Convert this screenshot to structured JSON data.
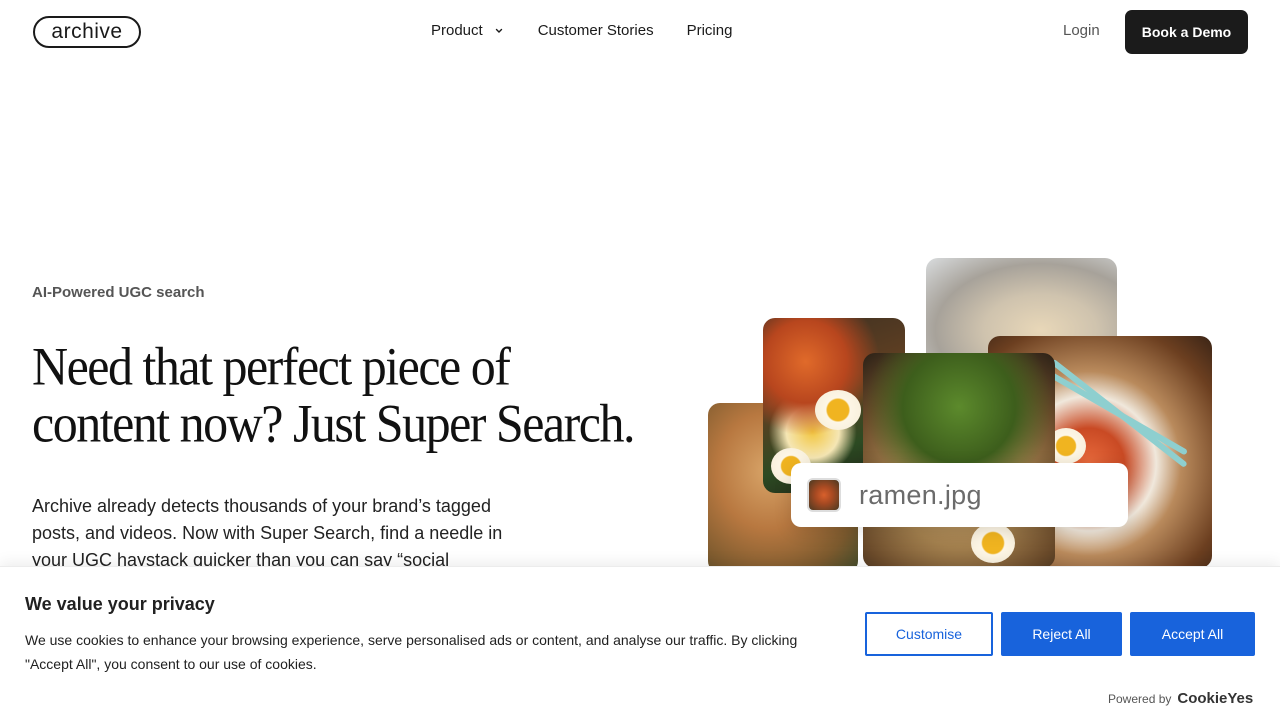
{
  "nav": {
    "logo": "archive",
    "links": [
      {
        "label": "Product",
        "has_dropdown": true
      },
      {
        "label": "Customer Stories"
      },
      {
        "label": "Pricing"
      }
    ],
    "login": "Login",
    "cta": "Book a Demo"
  },
  "hero": {
    "eyebrow": "AI-Powered UGC search",
    "headline": "Need that perfect piece of content now? Just Super Search.",
    "body": "Archive already detects thousands of your brand’s tagged posts, and videos. Now with Super Search, find a needle in your UGC haystack quicker than you can say “social",
    "search_result": "ramen.jpg"
  },
  "cookie_banner": {
    "title": "We value your privacy",
    "text": "We use cookies to enhance your browsing experience, serve personalised ads or content, and analyse our traffic. By clicking \"Accept All\", you consent to our use of cookies.",
    "customise": "Customise",
    "reject": "Reject All",
    "accept": "Accept All",
    "powered_by": "Powered by",
    "powered_brand": "CookieYes"
  },
  "colors": {
    "accent": "#1863dc",
    "cta_bg": "#1b1b1b"
  }
}
